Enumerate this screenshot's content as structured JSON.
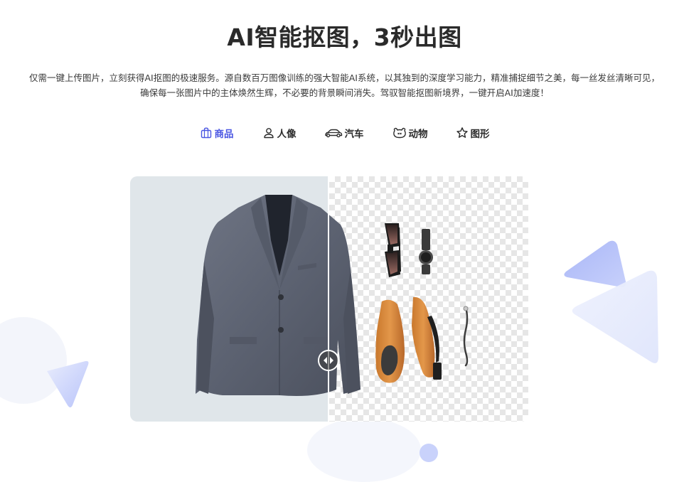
{
  "header": {
    "title": "AI智能抠图，3秒出图",
    "description_line1": "仅需一键上传图片，立刻获得AI抠图的极速服务。源自数百万图像训练的强大智能AI系统，以其独到的深度学习能力，精准捕捉细节之美，每一丝发丝清晰可见，",
    "description_line2": "确保每一张图片中的主体焕然生辉，不必要的背景瞬间消失。驾驭智能抠图新境界，一键开启AI加速度！"
  },
  "tabs": [
    {
      "label": "商品",
      "icon": "shopping-bag-icon",
      "active": true
    },
    {
      "label": "人像",
      "icon": "person-icon",
      "active": false
    },
    {
      "label": "汽车",
      "icon": "car-icon",
      "active": false
    },
    {
      "label": "动物",
      "icon": "animal-icon",
      "active": false
    },
    {
      "label": "图形",
      "icon": "star-icon",
      "active": false
    }
  ],
  "colors": {
    "accent": "#4a56e2",
    "text": "#2b2b2b",
    "before_bg": "#e0e6ea",
    "checker": "#e6e6e6"
  },
  "compare": {
    "split_fraction": 0.5
  }
}
